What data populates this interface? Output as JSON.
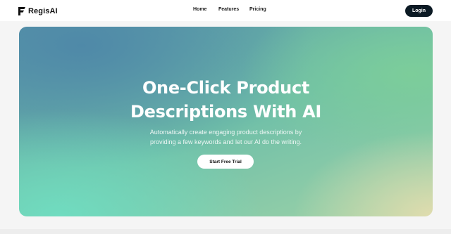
{
  "brand": {
    "name": "RegisAI",
    "logo_icon": "flag-icon"
  },
  "nav": {
    "links": [
      {
        "label": "Home"
      },
      {
        "label": "Features"
      },
      {
        "label": "Pricing"
      }
    ],
    "login_label": "Login"
  },
  "hero": {
    "title_line1": "One-Click Product",
    "title_line2": "Descriptions With AI",
    "subtitle_line1": "Automatically create engaging product descriptions by",
    "subtitle_line2": "providing a few keywords and let our AI do the writing.",
    "cta_label": "Start Free Trial"
  },
  "colors": {
    "login_bg": "#0c1a24",
    "hero_gradient": [
      "#4f89a8",
      "#70dcc0",
      "#7ccd9a",
      "#e0dcae"
    ]
  }
}
